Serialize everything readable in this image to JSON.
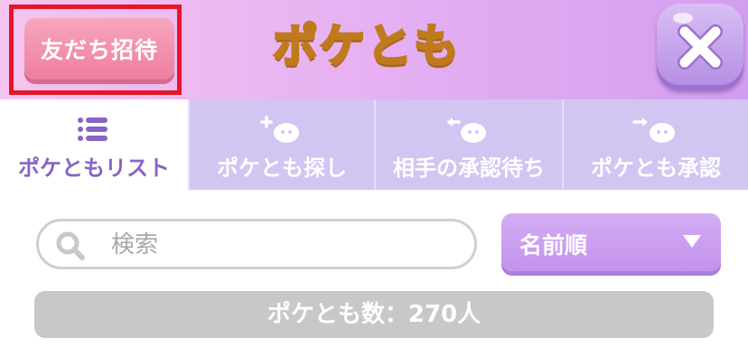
{
  "header": {
    "invite_label": "友だち招待",
    "title": "ポケとも",
    "close_icon": "close-icon"
  },
  "tabs": [
    {
      "label": "ポケともリスト",
      "icon": "list-icon",
      "active": true
    },
    {
      "label": "ポケとも探し",
      "icon": "add-pokemon-icon",
      "active": false
    },
    {
      "label": "相手の承認待ち",
      "icon": "pending-pokemon-icon",
      "active": false
    },
    {
      "label": "ポケとも承認",
      "icon": "approve-pokemon-icon",
      "active": false
    }
  ],
  "search": {
    "placeholder": "検索",
    "value": ""
  },
  "sort": {
    "selected": "名前順"
  },
  "count_text": "ポケとも数：270人",
  "colors": {
    "accent": "#8863c8",
    "tab_inactive": "#d2c5f2",
    "invite_pink": "#ef7e9f",
    "highlight_red": "#e5152a",
    "title_yellow": "#ffe07a"
  }
}
